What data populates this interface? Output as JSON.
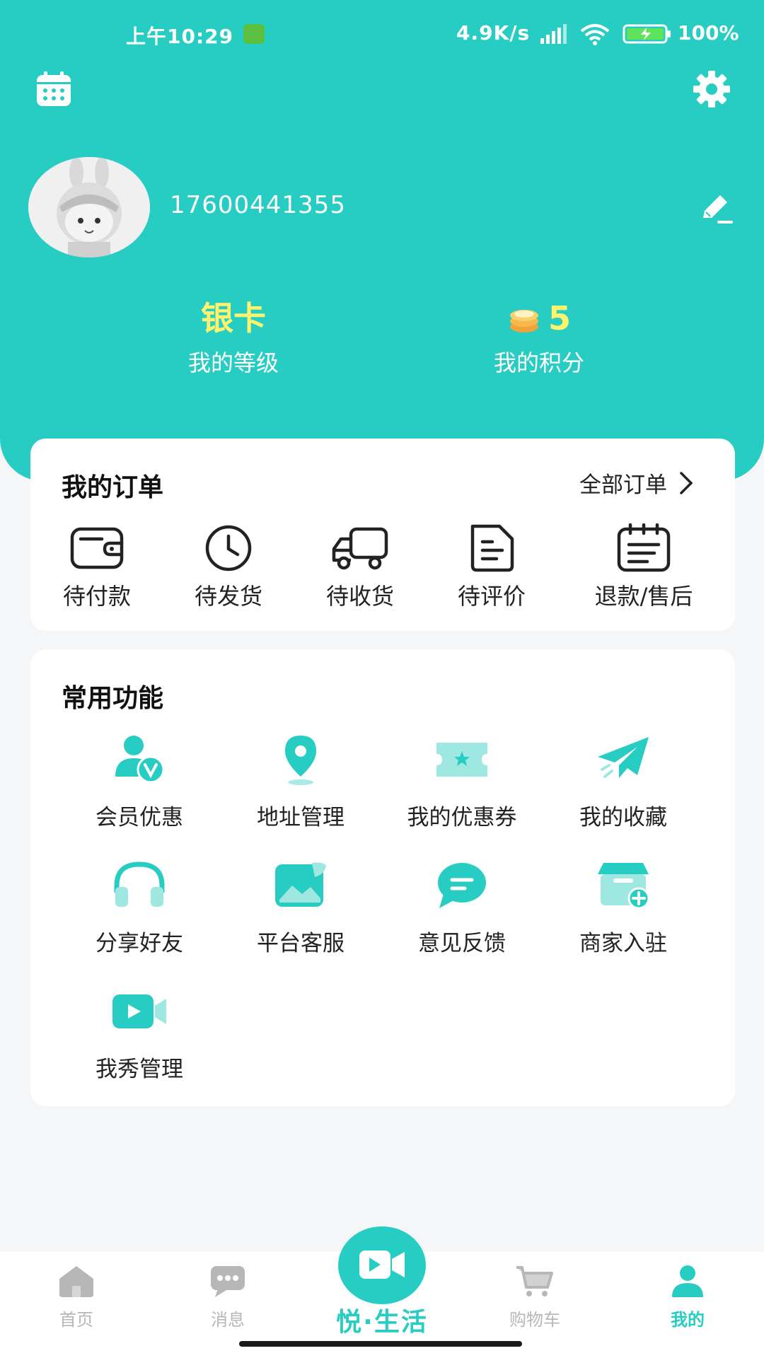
{
  "colors": {
    "brand": "#27cdc3",
    "level_accent": "#fff36e",
    "nav_inactive": "#b7b7b7"
  },
  "status_bar": {
    "time": "上午10:29",
    "net_speed": "4.9K/s",
    "battery": "100%"
  },
  "profile": {
    "phone": "17600441355"
  },
  "stats": {
    "level": {
      "value": "银卡",
      "label": "我的等级"
    },
    "points": {
      "value": "5",
      "label": "我的积分"
    }
  },
  "orders": {
    "title": "我的订单",
    "all_label": "全部订单",
    "items": [
      {
        "label": "待付款",
        "icon": "wallet-icon"
      },
      {
        "label": "待发货",
        "icon": "clock-icon"
      },
      {
        "label": "待收货",
        "icon": "truck-icon"
      },
      {
        "label": "待评价",
        "icon": "document-icon"
      },
      {
        "label": "退款/售后",
        "icon": "clipboard-icon"
      }
    ]
  },
  "functions": {
    "title": "常用功能",
    "items": [
      {
        "label": "会员优惠",
        "icon": "vip-user-icon"
      },
      {
        "label": "地址管理",
        "icon": "location-pin-icon"
      },
      {
        "label": "我的优惠券",
        "icon": "ticket-icon"
      },
      {
        "label": "我的收藏",
        "icon": "paper-plane-icon"
      },
      {
        "label": "分享好友",
        "icon": "headphones-icon"
      },
      {
        "label": "平台客服",
        "icon": "image-icon"
      },
      {
        "label": "意见反馈",
        "icon": "chat-bubble-icon"
      },
      {
        "label": "商家入驻",
        "icon": "store-add-icon"
      },
      {
        "label": "我秀管理",
        "icon": "video-icon"
      }
    ]
  },
  "bottom_nav": {
    "items": [
      {
        "label": "首页",
        "icon": "home-icon"
      },
      {
        "label": "消息",
        "icon": "message-icon"
      },
      {
        "label": "购物车",
        "icon": "cart-icon"
      },
      {
        "label": "我的",
        "icon": "user-icon",
        "active": true
      }
    ],
    "center_label": "悦·生活"
  }
}
